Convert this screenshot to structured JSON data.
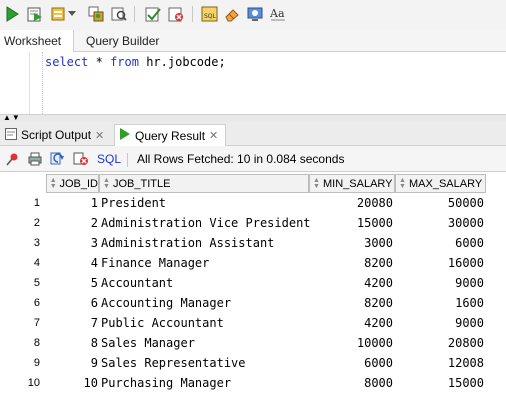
{
  "toolbar": {
    "icons": [
      "run-statement-icon",
      "run-script-icon",
      "autotrace-icon",
      "explain-plan-icon",
      "sql-tuning-icon",
      "commit-icon",
      "rollback-icon",
      "sql-history-icon",
      "eraser-icon",
      "monitor-icon",
      "format-case-icon"
    ]
  },
  "worksheet_tabs": {
    "worksheet": "Worksheet",
    "query_builder": "Query Builder"
  },
  "editor": {
    "kw_select": "select",
    "star": "*",
    "kw_from": "from",
    "table": "hr.jobcode;"
  },
  "result_tabs": {
    "script_output": "Script Output",
    "query_result": "Query Result"
  },
  "result_toolbar": {
    "sql": "SQL",
    "status": "All Rows Fetched: 10 in 0.084 seconds"
  },
  "grid": {
    "columns": [
      "JOB_ID",
      "JOB_TITLE",
      "MIN_SALARY",
      "MAX_SALARY"
    ],
    "rows": [
      {
        "n": "1",
        "id": "1",
        "title": "President",
        "min": "20080",
        "max": "50000"
      },
      {
        "n": "2",
        "id": "2",
        "title": "Administration Vice President",
        "min": "15000",
        "max": "30000"
      },
      {
        "n": "3",
        "id": "3",
        "title": "Administration Assistant",
        "min": "3000",
        "max": "6000"
      },
      {
        "n": "4",
        "id": "4",
        "title": "Finance Manager",
        "min": "8200",
        "max": "16000"
      },
      {
        "n": "5",
        "id": "5",
        "title": "Accountant",
        "min": "4200",
        "max": "9000"
      },
      {
        "n": "6",
        "id": "6",
        "title": "Accounting Manager",
        "min": "8200",
        "max": "1600"
      },
      {
        "n": "7",
        "id": "7",
        "title": "Public Accountant",
        "min": "4200",
        "max": "9000"
      },
      {
        "n": "8",
        "id": "8",
        "title": "Sales Manager",
        "min": "10000",
        "max": "20800"
      },
      {
        "n": "9",
        "id": "9",
        "title": "Sales Representative",
        "min": "6000",
        "max": "12008"
      },
      {
        "n": "10",
        "id": "10",
        "title": "Purchasing Manager",
        "min": "8000",
        "max": "15000"
      }
    ]
  },
  "colors": {
    "keyword": "#1f35c7",
    "run_green": "#2e9e2e"
  }
}
